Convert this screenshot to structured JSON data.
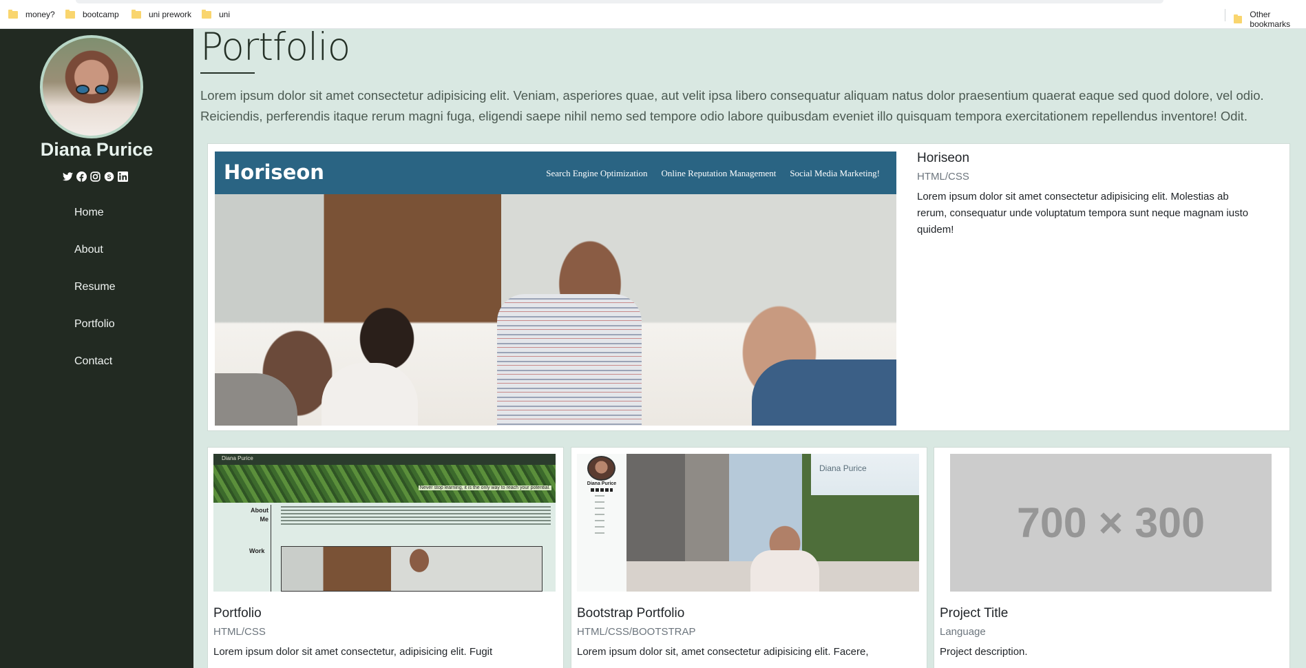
{
  "bookmarks": {
    "items": [
      "money?",
      "bootcamp",
      "uni prework",
      "uni"
    ],
    "other": "Other bookmarks"
  },
  "sidebar": {
    "name": "Diana Purice",
    "socials": [
      "twitter-icon",
      "facebook-icon",
      "instagram-icon",
      "skype-icon",
      "linkedin-icon"
    ],
    "nav": [
      "Home",
      "About",
      "Resume",
      "Portfolio",
      "Contact"
    ]
  },
  "main": {
    "title": "Portfolio",
    "intro": "Lorem ipsum dolor sit amet consectetur adipisicing elit. Veniam, asperiores quae, aut velit ipsa libero consequatur aliquam natus dolor praesentium quaerat eaque sed quod dolore, vel odio. Reiciendis, perferendis itaque rerum magni fuga, eligendi saepe nihil nemo sed tempore odio labore quibusdam eveniet illo quisquam tempora exercitationem repellendus inventore! Odit.",
    "featured": {
      "image": {
        "brand": "Horiseon",
        "links": [
          "Search Engine Optimization",
          "Online Reputation Management",
          "Social Media Marketing!"
        ]
      },
      "title": "Horiseon",
      "language": "HTML/CSS",
      "description": "Lorem ipsum dolor sit amet consectetur adipisicing elit. Molestias ab rerum, consequatur unde voluptatum tempora sunt neque magnam iusto quidem!"
    },
    "cards": [
      {
        "thumb": {
          "name": "Diana Purice",
          "motto": "Never stop learning, it is the only way to reach your potential.",
          "about": "About Me",
          "work": "Work"
        },
        "title": "Portfolio",
        "language": "HTML/CSS",
        "description": "Lorem ipsum dolor sit amet consectetur, adipisicing elit. Fugit"
      },
      {
        "thumb": {
          "name": "Diana Purice",
          "header": "Diana Purice"
        },
        "title": "Bootstrap Portfolio",
        "language": "HTML/CSS/BOOTSTRAP",
        "description": "Lorem ipsum dolor sit, amet consectetur adipisicing elit. Facere,"
      },
      {
        "thumb": {
          "placeholder": "700 × 300"
        },
        "title": "Project Title",
        "language": "Language",
        "description": "Project description."
      }
    ]
  }
}
